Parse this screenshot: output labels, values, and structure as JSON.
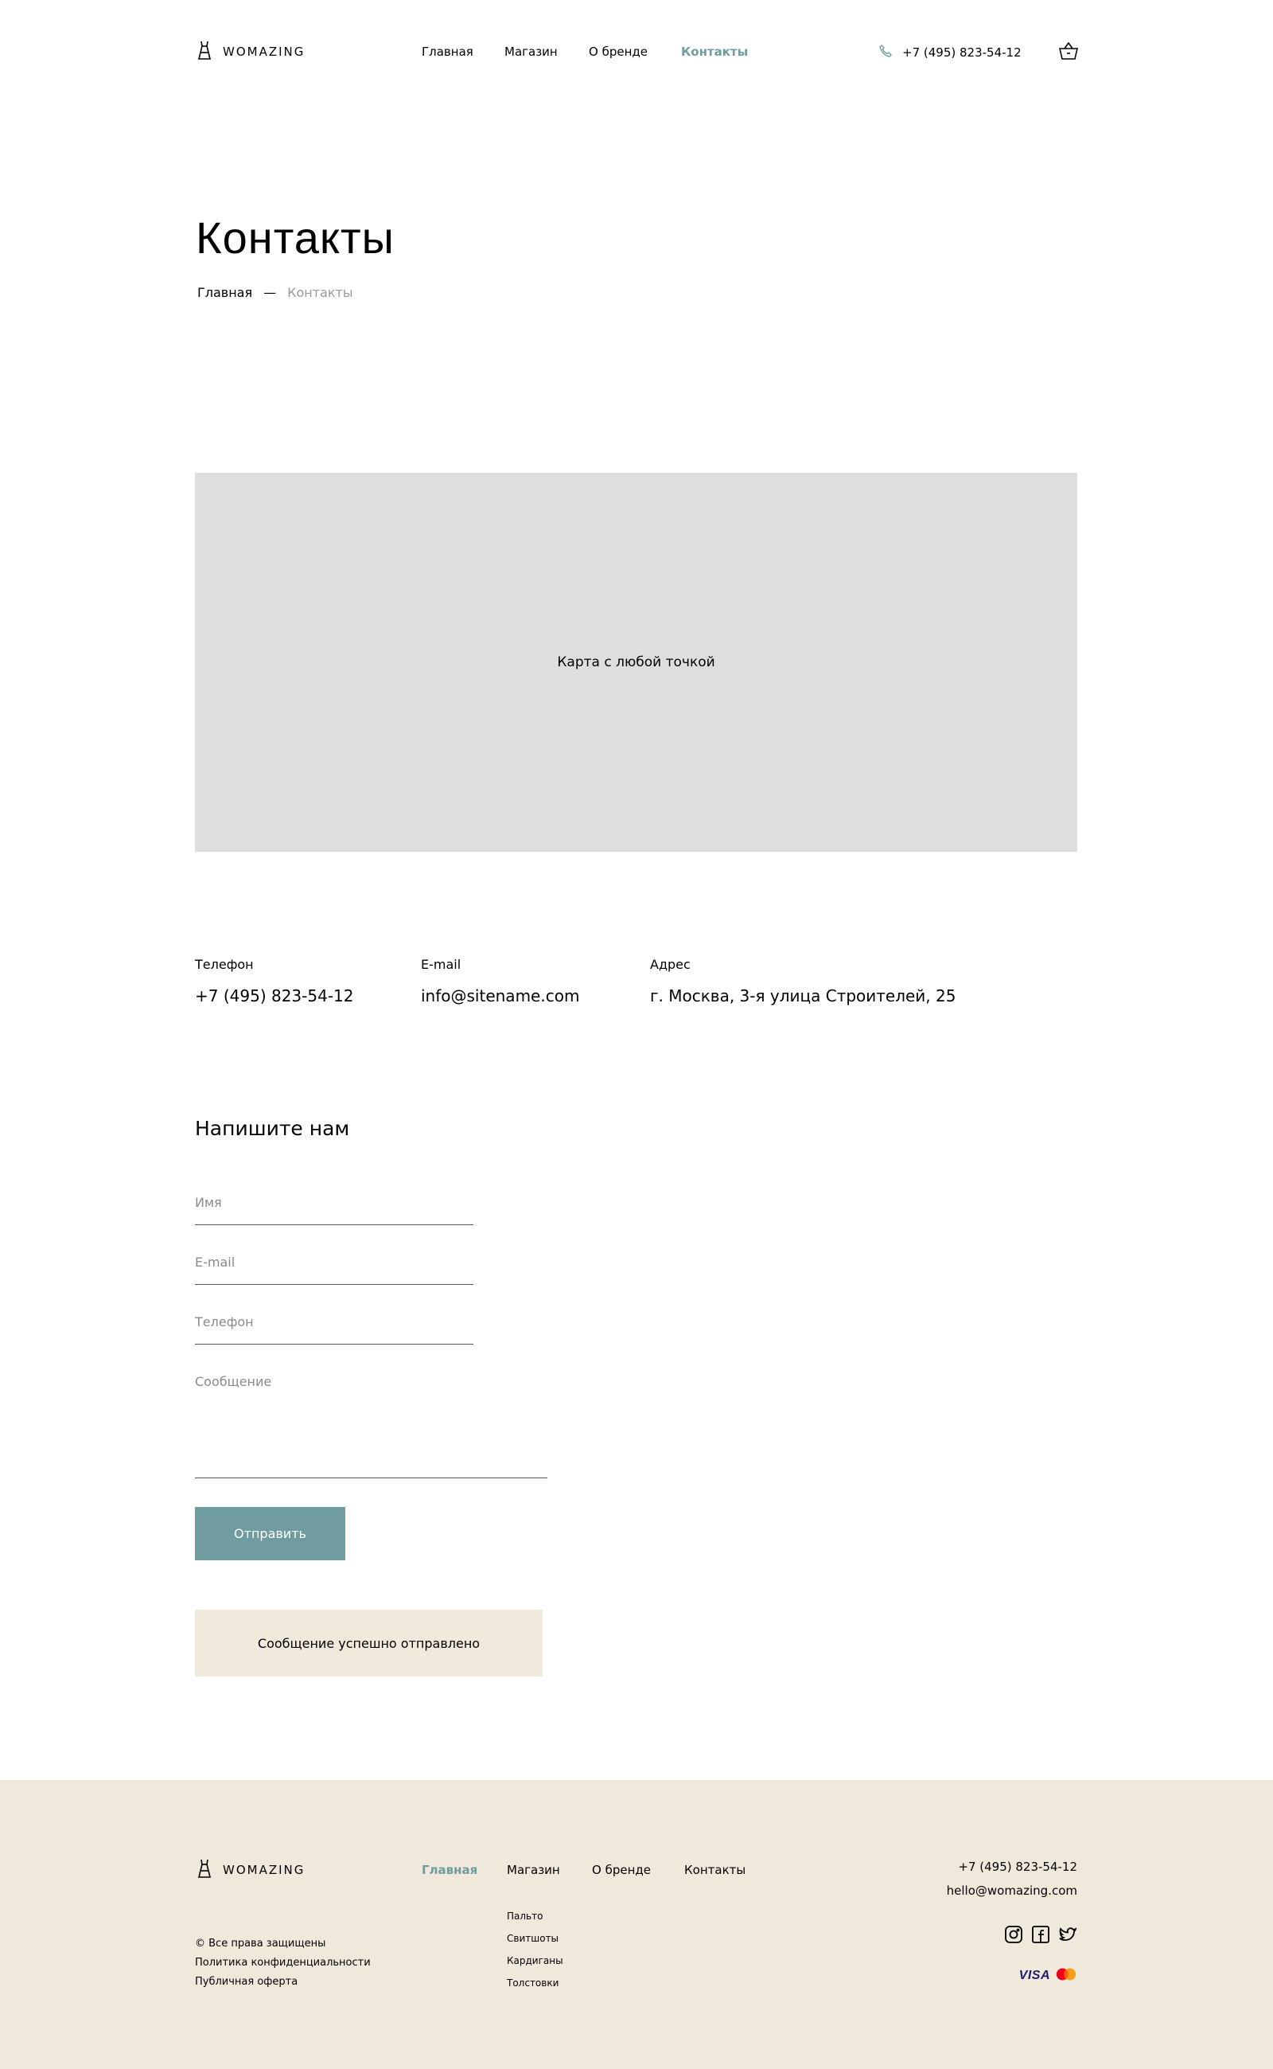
{
  "brand": {
    "name": "WOMAZING"
  },
  "header": {
    "nav": [
      {
        "label": "Главная",
        "active": false
      },
      {
        "label": "Магазин",
        "active": false
      },
      {
        "label": "О бренде",
        "active": false
      },
      {
        "label": "Контакты",
        "active": true
      }
    ],
    "phone": "+7 (495) 823-54-12"
  },
  "page": {
    "title": "Контакты",
    "breadcrumb": {
      "home": "Главная",
      "separator": "—",
      "current": "Контакты"
    }
  },
  "map": {
    "label": "Карта с любой точкой"
  },
  "contacts": {
    "phone_label": "Телефон",
    "phone_value": "+7 (495) 823-54-12",
    "email_label": "E-mail",
    "email_value": "info@sitename.com",
    "address_label": "Адрес",
    "address_value": "г. Москва, 3-я улица Строителей, 25"
  },
  "form": {
    "title": "Напишите нам",
    "name_placeholder": "Имя",
    "email_placeholder": "E-mail",
    "phone_placeholder": "Телефон",
    "message_placeholder": "Сообщение",
    "submit_label": "Отправить",
    "success_message": "Сообщение успешно отправлено"
  },
  "footer": {
    "nav": [
      {
        "label": "Главная",
        "active": true
      },
      {
        "label": "Магазин",
        "active": false
      },
      {
        "label": "О бренде",
        "active": false
      },
      {
        "label": "Контакты",
        "active": false
      }
    ],
    "shop_categories": [
      "Пальто",
      "Свитшоты",
      "Кардиганы",
      "Толстовки"
    ],
    "legal": [
      "© Все права защищены",
      "Политика конфиденциальности",
      "Публичная оферта"
    ],
    "phone": "+7 (495) 823-54-12",
    "email": "hello@womazing.com",
    "social_icons": [
      "instagram-icon",
      "facebook-icon",
      "twitter-icon"
    ],
    "payment": {
      "visa": "VISA"
    }
  },
  "colors": {
    "accent": "#6E9C9F",
    "beige": "#F1E8DC",
    "map_gray": "#DEDEDE"
  }
}
